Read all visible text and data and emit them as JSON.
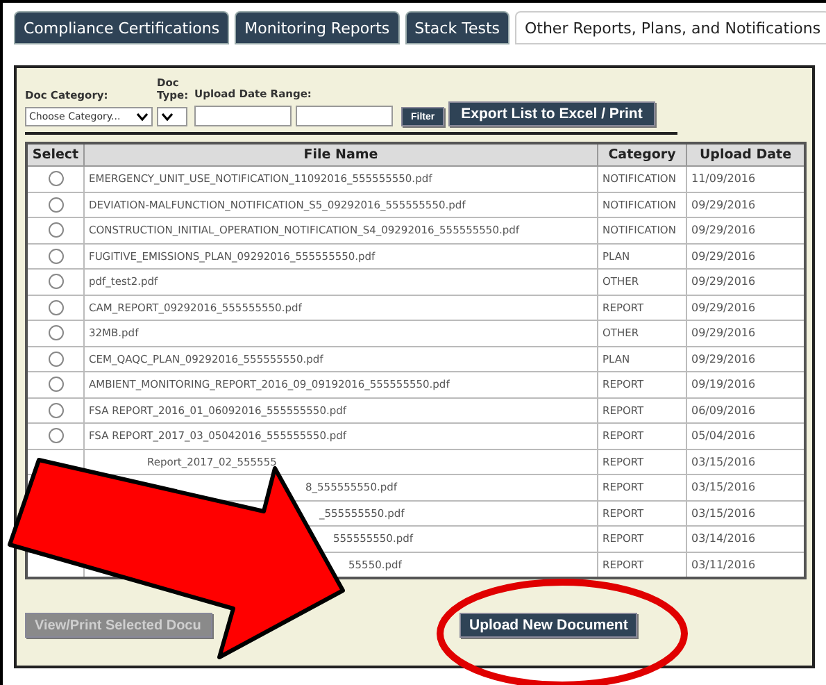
{
  "tabs": [
    {
      "label": "Compliance Certifications",
      "selected": false
    },
    {
      "label": "Monitoring Reports",
      "selected": false
    },
    {
      "label": "Stack Tests",
      "selected": false
    },
    {
      "label": "Other Reports, Plans, and Notifications",
      "selected": true
    }
  ],
  "filters": {
    "doc_category_label": "Doc Category:",
    "doc_type_label": "Doc Type:",
    "date_range_label": "Upload Date Range:",
    "category_select": "Choose Category...",
    "filter_button": "Filter",
    "export_button": "Export List to Excel / Print"
  },
  "table": {
    "columns": [
      "Select",
      "File Name",
      "Category",
      "Upload Date"
    ],
    "rows": [
      {
        "selected": false,
        "file": "EMERGENCY_UNIT_USE_NOTIFICATION_11092016_555555550.pdf",
        "category": "NOTIFICATION",
        "date": "11/09/2016"
      },
      {
        "selected": false,
        "file": "DEVIATION-MALFUNCTION_NOTIFICATION_S5_09292016_555555550.pdf",
        "category": "NOTIFICATION",
        "date": "09/29/2016"
      },
      {
        "selected": false,
        "file": "CONSTRUCTION_INITIAL_OPERATION_NOTIFICATION_S4_09292016_555555550.pdf",
        "category": "NOTIFICATION",
        "date": "09/29/2016"
      },
      {
        "selected": false,
        "file": "FUGITIVE_EMISSIONS_PLAN_09292016_555555550.pdf",
        "category": "PLAN",
        "date": "09/29/2016"
      },
      {
        "selected": false,
        "file": "pdf_test2.pdf",
        "category": "OTHER",
        "date": "09/29/2016"
      },
      {
        "selected": false,
        "file": "CAM_REPORT_09292016_555555550.pdf",
        "category": "REPORT",
        "date": "09/29/2016"
      },
      {
        "selected": false,
        "file": "32MB.pdf",
        "category": "OTHER",
        "date": "09/29/2016"
      },
      {
        "selected": false,
        "file": "CEM_QAQC_PLAN_09292016_555555550.pdf",
        "category": "PLAN",
        "date": "09/29/2016"
      },
      {
        "selected": false,
        "file": "AMBIENT_MONITORING_REPORT_2016_09_09192016_555555550.pdf",
        "category": "REPORT",
        "date": "09/19/2016"
      },
      {
        "selected": false,
        "file": "FSA REPORT_2016_01_06092016_555555550.pdf",
        "category": "REPORT",
        "date": "06/09/2016"
      },
      {
        "selected": false,
        "file": "FSA REPORT_2017_03_05042016_555555550.pdf",
        "category": "REPORT",
        "date": "05/04/2016"
      },
      {
        "file": "Report_2017_02_555555",
        "category": "REPORT",
        "date": "03/15/2016"
      },
      {
        "file": "8_555555550.pdf",
        "category": "REPORT",
        "date": "03/15/2016"
      },
      {
        "file": "_555555550.pdf",
        "category": "REPORT",
        "date": "03/15/2016"
      },
      {
        "file": "555555550.pdf",
        "category": "REPORT",
        "date": "03/14/2016"
      },
      {
        "file": "55550.pdf",
        "category": "REPORT",
        "date": "03/11/2016"
      }
    ]
  },
  "view_print_button": {
    "label": "View/Print Selected Docu",
    "disabled": true
  },
  "upload_button": "Upload New Document"
}
